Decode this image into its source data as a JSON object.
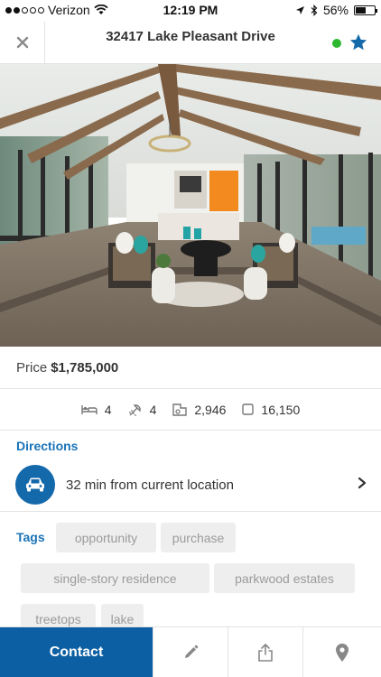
{
  "status_bar": {
    "carrier": "Verizon",
    "time": "12:19 PM",
    "battery_percent": "56%",
    "battery_level": 0.56,
    "signal_bars_filled": 2,
    "signal_bars_total": 5
  },
  "header": {
    "title": "32417 Lake Pleasant Drive",
    "online_color": "#2eb82e",
    "star_color": "#1469ab"
  },
  "listing": {
    "price_label": "Price",
    "price_value": "$1,785,000",
    "beds": "4",
    "baths": "4",
    "sqft": "2,946",
    "lot": "16,150"
  },
  "directions": {
    "label": "Directions",
    "text": "32 min from current location"
  },
  "tags": {
    "label": "Tags",
    "items": [
      "opportunity",
      "purchase",
      "single-story residence",
      "parkwood estates",
      "treetops",
      "lake"
    ]
  },
  "toolbar": {
    "contact_label": "Contact",
    "accent": "#0d5fa3"
  }
}
